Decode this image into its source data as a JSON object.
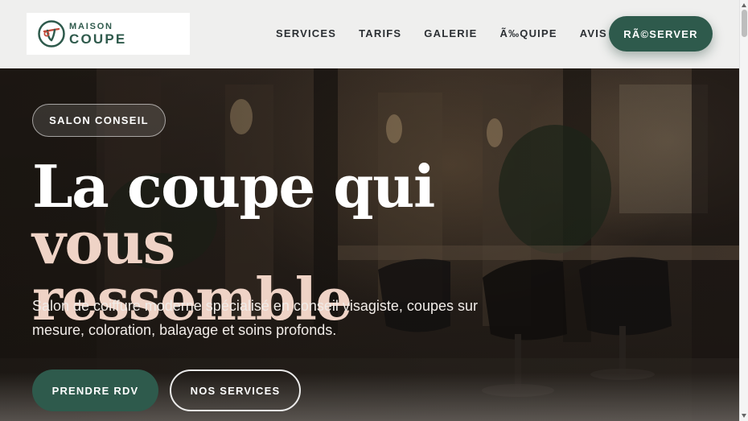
{
  "brand": {
    "line1": "MAISON",
    "line2": "COUPE",
    "logo_icon": "scissors-in-circle-icon",
    "colors": {
      "green": "#2e5a4c",
      "accent": "#c24a3a"
    }
  },
  "nav": {
    "items": [
      {
        "label": "SERVICES"
      },
      {
        "label": "TARIFS"
      },
      {
        "label": "GALERIE"
      },
      {
        "label": "Ã‰QUIPE"
      },
      {
        "label": "AVIS"
      }
    ],
    "cta_label": "RÃ©SERVER"
  },
  "hero": {
    "badge": "SALON CONSEIL",
    "title_white": "La coupe qui ",
    "title_accent_1": "vous",
    "title_accent_2": "ressemble",
    "subtitle": "Salon de coiffure moderne spécialisé en conseil visagiste, coupes sur mesure, coloration, balayage et soins profonds.",
    "primary_button": "PRENDRE RDV",
    "secondary_button": "NOS SERVICES",
    "colors": {
      "title_accent": "#efd3c6",
      "overlay": "#1f1a16"
    }
  }
}
